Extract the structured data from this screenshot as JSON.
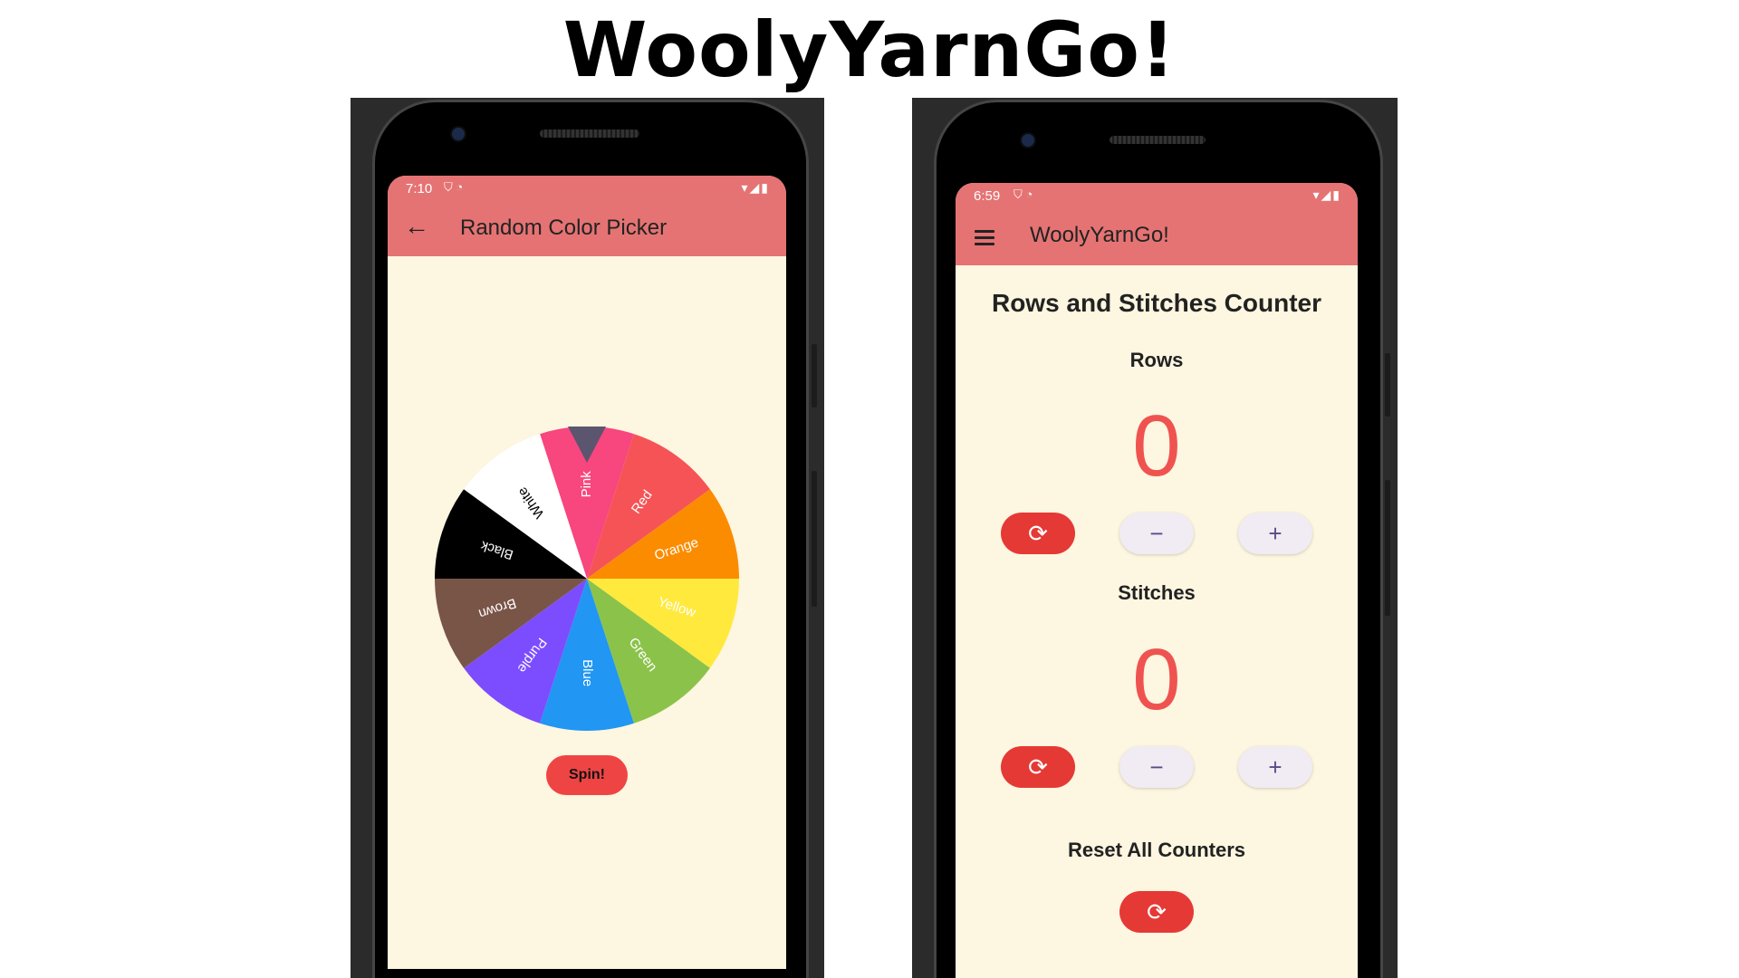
{
  "page_title": "WoolyYarnGo!",
  "left_phone": {
    "status": {
      "time": "7:10",
      "left_icons": "⛉ ◔",
      "right_icons": "▾◢▮"
    },
    "appbar": {
      "back_icon": "←",
      "title": "Random Color Picker"
    },
    "wheel": {
      "segments": [
        {
          "label": "Pink",
          "color": "#f8467e",
          "text_color": "#ffffff"
        },
        {
          "label": "Red",
          "color": "#f65356",
          "text_color": "#ffffff"
        },
        {
          "label": "Orange",
          "color": "#fb8c00",
          "text_color": "#ffffff"
        },
        {
          "label": "Yellow",
          "color": "#ffe93d",
          "text_color": "#ffffff"
        },
        {
          "label": "Green",
          "color": "#8bc34a",
          "text_color": "#ffffff"
        },
        {
          "label": "Blue",
          "color": "#2196f3",
          "text_color": "#ffffff"
        },
        {
          "label": "Purple",
          "color": "#7c4dff",
          "text_color": "#ffffff"
        },
        {
          "label": "Brown",
          "color": "#795548",
          "text_color": "#ffffff"
        },
        {
          "label": "Black",
          "color": "#000000",
          "text_color": "#ffffff"
        },
        {
          "label": "White",
          "color": "#ffffff",
          "text_color": "#000000"
        }
      ],
      "pointer_color": "#5b5570"
    },
    "spin_label": "Spin!"
  },
  "right_phone": {
    "status": {
      "time": "6:59",
      "left_icons": "⛉ ◔",
      "right_icons": "▾◢▮"
    },
    "appbar": {
      "title": "WoolyYarnGo!"
    },
    "heading": "Rows and Stitches Counter",
    "rows": {
      "label": "Rows",
      "value": "0"
    },
    "stitches": {
      "label": "Stitches",
      "value": "0"
    },
    "icons": {
      "reset": "⟳",
      "minus": "−",
      "plus": "+"
    },
    "reset_all_label": "Reset All Counters"
  },
  "colors": {
    "appbar": "#e57373",
    "screen_bg": "#fdf6e0",
    "accent_red": "#ef5350"
  }
}
